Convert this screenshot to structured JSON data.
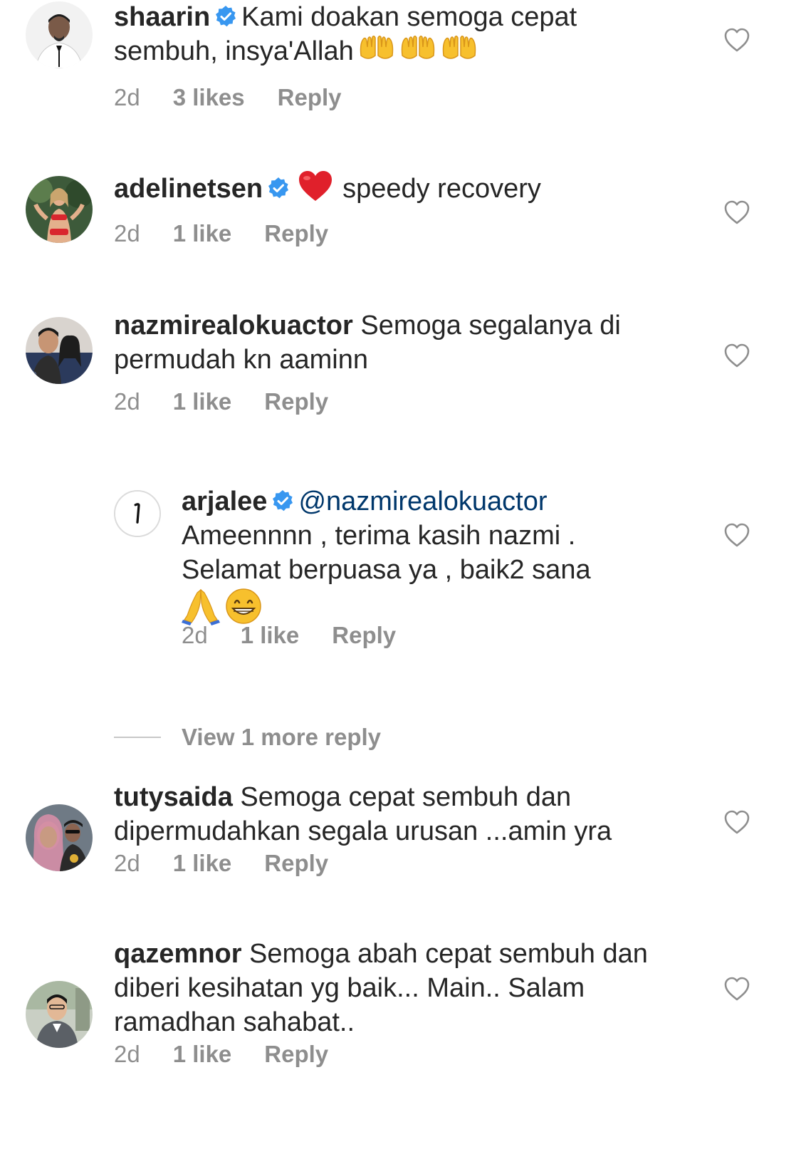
{
  "comments": [
    {
      "username": "shaarin",
      "verified": true,
      "text": "Kami doakan semoga cepat sembuh, insya'Allah",
      "emoji": [
        "open-hands",
        "open-hands",
        "open-hands"
      ],
      "time": "2d",
      "likes": "3 likes",
      "reply_label": "Reply"
    },
    {
      "username": "adelinetsen",
      "verified": true,
      "text": "speedy recovery",
      "emoji": [
        "red-heart"
      ],
      "time": "2d",
      "likes": "1 like",
      "reply_label": "Reply"
    },
    {
      "username": "nazmirealokuactor",
      "verified": false,
      "text": "Semoga segalanya di permudah kn aaminn",
      "time": "2d",
      "likes": "1 like",
      "reply_label": "Reply"
    },
    {
      "username": "arjalee",
      "verified": true,
      "mention": "@nazmirealokuactor",
      "text": "Ameennnn , terima kasih nazmi . Selamat berpuasa ya , baik2 sana",
      "emoji": [
        "folded-hands",
        "grinning-face"
      ],
      "time": "2d",
      "likes": "1 like",
      "reply_label": "Reply",
      "is_reply": true
    },
    {
      "username": "tutysaida",
      "verified": false,
      "text": "Semoga cepat sembuh dan dipermudahkan segala urusan ...amin yra",
      "time": "2d",
      "likes": "1 like",
      "reply_label": "Reply"
    },
    {
      "username": "qazemnor",
      "verified": false,
      "text": "Semoga abah cepat sembuh dan diberi kesihatan yg baik... Main.. Salam ramadhan sahabat..",
      "time": "2d",
      "likes": "1 like",
      "reply_label": "Reply"
    }
  ],
  "view_more_replies": "View 1 more reply",
  "colors": {
    "text": "#262626",
    "meta": "#8e8e8e",
    "mention": "#00376b",
    "verified": "#3897f0",
    "heart_outline": "#8e8e8e"
  },
  "icons": {
    "like": "heart-outline-icon",
    "verified": "verified-badge-icon"
  }
}
